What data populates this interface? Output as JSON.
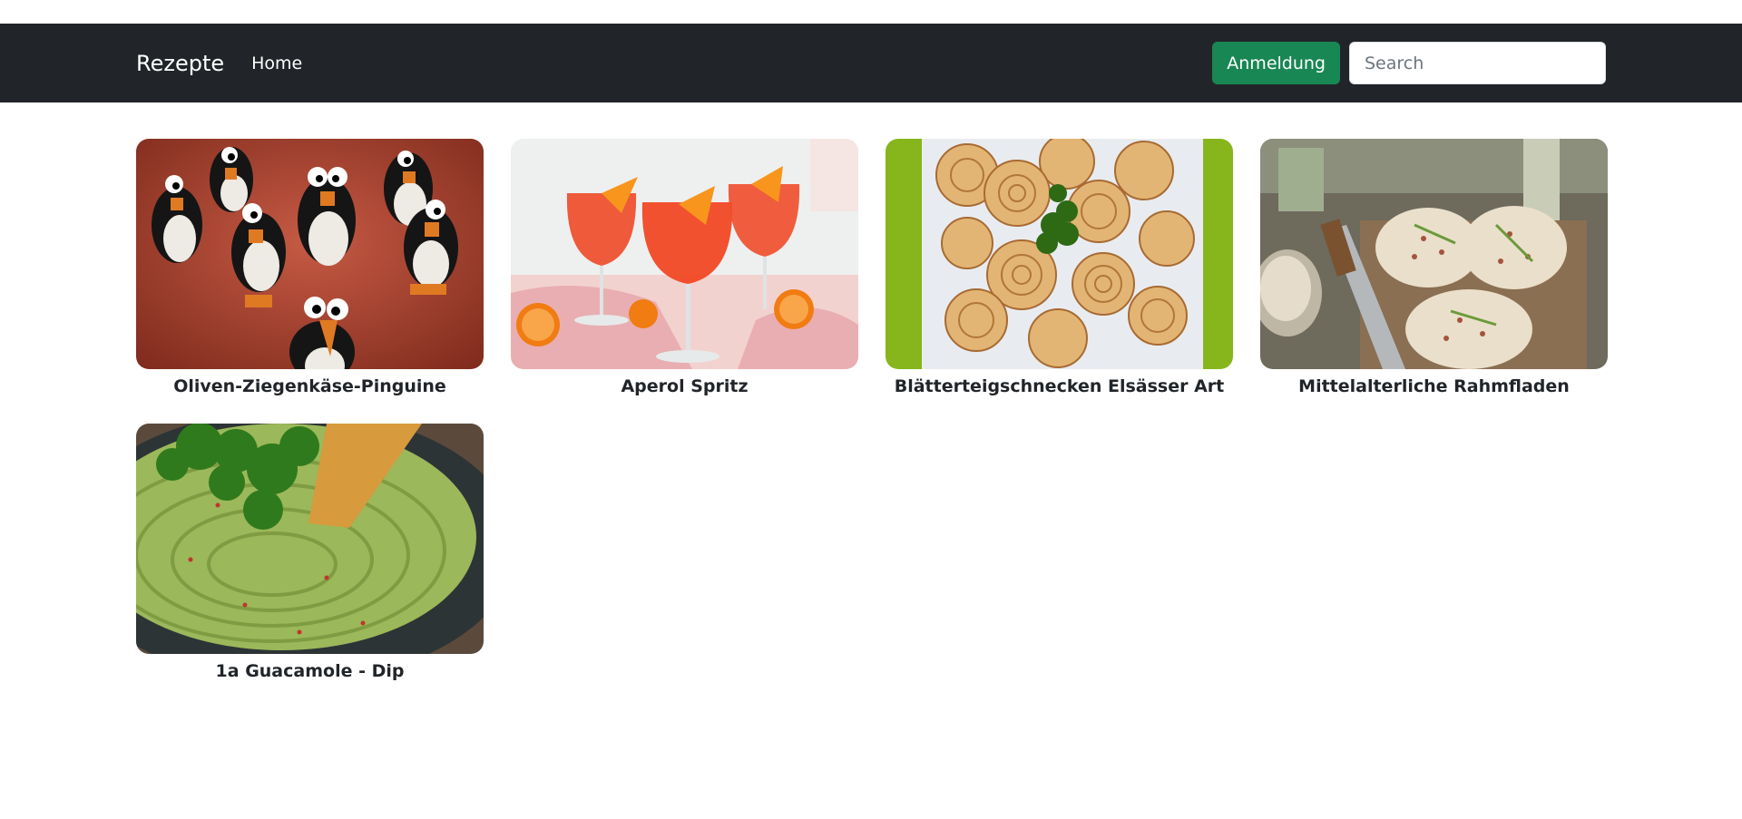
{
  "navbar": {
    "brand": "Rezepte",
    "home_label": "Home",
    "login_label": "Anmeldung",
    "search_placeholder": "Search"
  },
  "colors": {
    "navbar_bg": "#212529",
    "login_bg": "#198754"
  },
  "recipes": [
    {
      "title": "Oliven-Ziegenkäse-Pinguine"
    },
    {
      "title": "Aperol Spritz"
    },
    {
      "title": "Blätterteigschnecken Elsässer Art"
    },
    {
      "title": "Mittelalterliche Rahmfladen"
    },
    {
      "title": "1a Guacamole - Dip"
    }
  ]
}
